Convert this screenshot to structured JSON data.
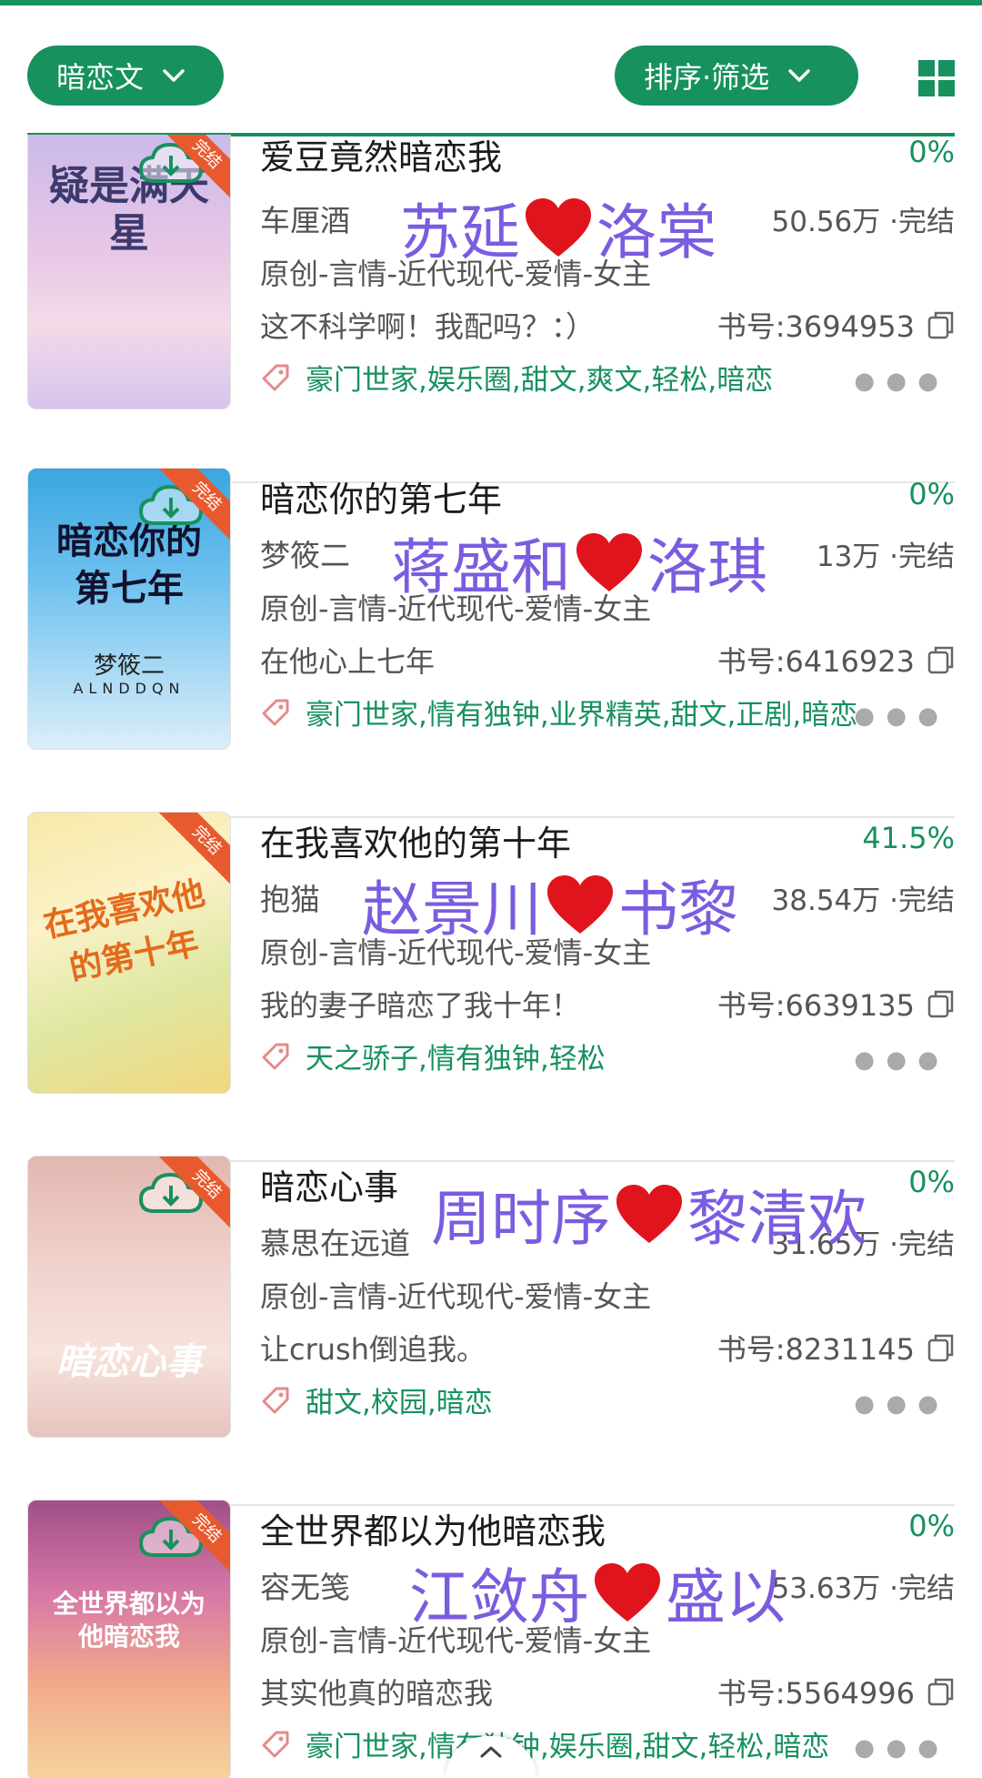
{
  "header": {
    "category_label": "暗恋文",
    "sort_label": "排序·筛选"
  },
  "colors": {
    "accent": "#17915e",
    "overlay": "#7b5ce0",
    "heart": "#e0141c",
    "badge": "#e85a2e"
  },
  "books": [
    {
      "title": "爱豆竟然暗恋我",
      "progress": "0%",
      "author": "车厘酒",
      "stats": "50.56万 ·完结",
      "category": "原创-言情-近代现代-爱情-女主",
      "intro": "这不科学啊！我配吗？：）",
      "book_no": "书号:3694953",
      "tags": "豪门世家,娱乐圈,甜文,爽文,轻松,暗恋",
      "cover_title": "疑是满天星",
      "cover_badge": "完结",
      "overlay_left": "苏延",
      "overlay_right": "洛棠"
    },
    {
      "title": "暗恋你的第七年",
      "progress": "0%",
      "author": "梦筱二",
      "stats": "13万 ·完结",
      "category": "原创-言情-近代现代-爱情-女主",
      "intro": "在他心上七年",
      "book_no": "书号:6416923",
      "tags": "豪门世家,情有独钟,业界精英,甜文,正剧,暗恋",
      "cover_title": "暗恋你的第七年",
      "cover_author": "梦筱二",
      "cover_sub": "ALNDDQN",
      "cover_badge": "完结",
      "overlay_left": "蒋盛和",
      "overlay_right": "洛琪"
    },
    {
      "title": "在我喜欢他的第十年",
      "progress": "41.5%",
      "author": "抱猫",
      "stats": "38.54万 ·完结",
      "category": "原创-言情-近代现代-爱情-女主",
      "intro": "我的妻子暗恋了我十年！",
      "book_no": "书号:6639135",
      "tags": "天之骄子,情有独钟,轻松",
      "cover_title": "在我喜欢他的第十年",
      "cover_badge": "完结",
      "overlay_left": "赵景川",
      "overlay_right": "书黎"
    },
    {
      "title": "暗恋心事",
      "progress": "0%",
      "author": "慕思在远道",
      "stats": "31.65万 ·完结",
      "category": "原创-言情-近代现代-爱情-女主",
      "intro": "让crush倒追我。",
      "book_no": "书号:8231145",
      "tags": "甜文,校园,暗恋",
      "cover_title": "暗恋心事",
      "cover_badge": "完结",
      "overlay_left": "周时序",
      "overlay_right": "黎清欢"
    },
    {
      "title": "全世界都以为他暗恋我",
      "progress": "0%",
      "author": "容无笺",
      "stats": "53.63万 ·完结",
      "category": "原创-言情-近代现代-爱情-女主",
      "intro": "其实他真的暗恋我",
      "book_no": "书号:5564996",
      "tags": "豪门世家,情有独钟,娱乐圈,甜文,轻松,暗恋",
      "cover_title": "全世界都以为他暗恋我",
      "cover_badge": "完结",
      "overlay_left": "江敛舟",
      "overlay_right": "盛以"
    }
  ]
}
